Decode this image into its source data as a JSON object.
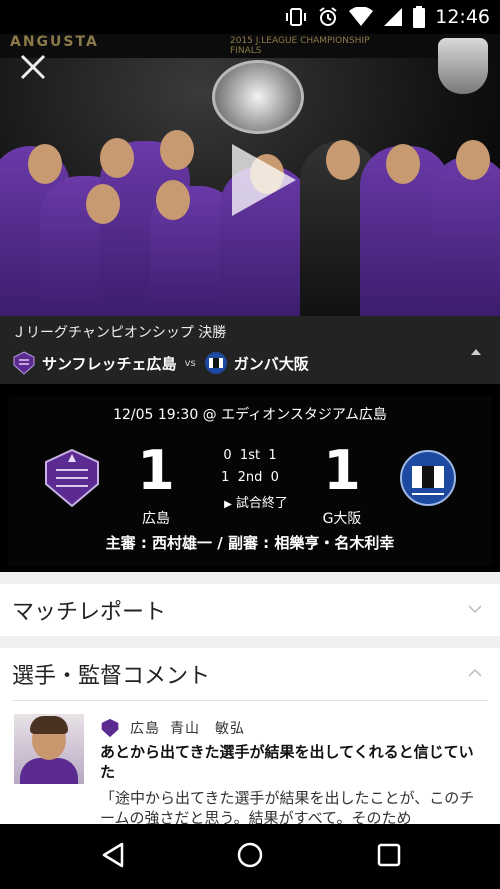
{
  "status_bar": {
    "time": "12:46",
    "icons": [
      "vibrate-icon",
      "alarm-icon",
      "wifi-icon",
      "signal-icon",
      "battery-icon"
    ]
  },
  "hero": {
    "banner_left": "ANGUSTA",
    "banner_right": "2015 J.LEAGUE CHAMPIONSHIP\nFINALS",
    "close_icon": "close-icon",
    "play_icon": "play-icon"
  },
  "match_header": {
    "competition": "Ｊリーグチャンピオンシップ 決勝",
    "home_team": "サンフレッチェ広島",
    "vs": "vs",
    "away_team": "ガンバ大阪"
  },
  "scoreboard": {
    "venue": "12/05 19:30 @ エディオンスタジアム広島",
    "home_score": "1",
    "away_score": "1",
    "first_half": "0  1st  1",
    "second_half": "1  2nd  0",
    "status": "試合終了",
    "home_abbr": "広島",
    "away_abbr": "G大阪",
    "referees": "主審 : 西村雄一 / 副審 : 相樂亨・名木利幸"
  },
  "sections": {
    "report_title": "マッチレポート",
    "comments_title": "選手・監督コメント"
  },
  "comment": {
    "club": "広島",
    "name": "青山　敏弘",
    "title": "あとから出てきた選手が結果を出してくれると信じていた",
    "body": "「途中から出てきた選手が結果を出したことが、このチームの強さだと思う。結果がすべて。そのため"
  },
  "colors": {
    "sanfrecce": "#5b2b92",
    "gamba": "#1d4aa0",
    "board_bg": "#050505",
    "header_bg": "#232323"
  }
}
